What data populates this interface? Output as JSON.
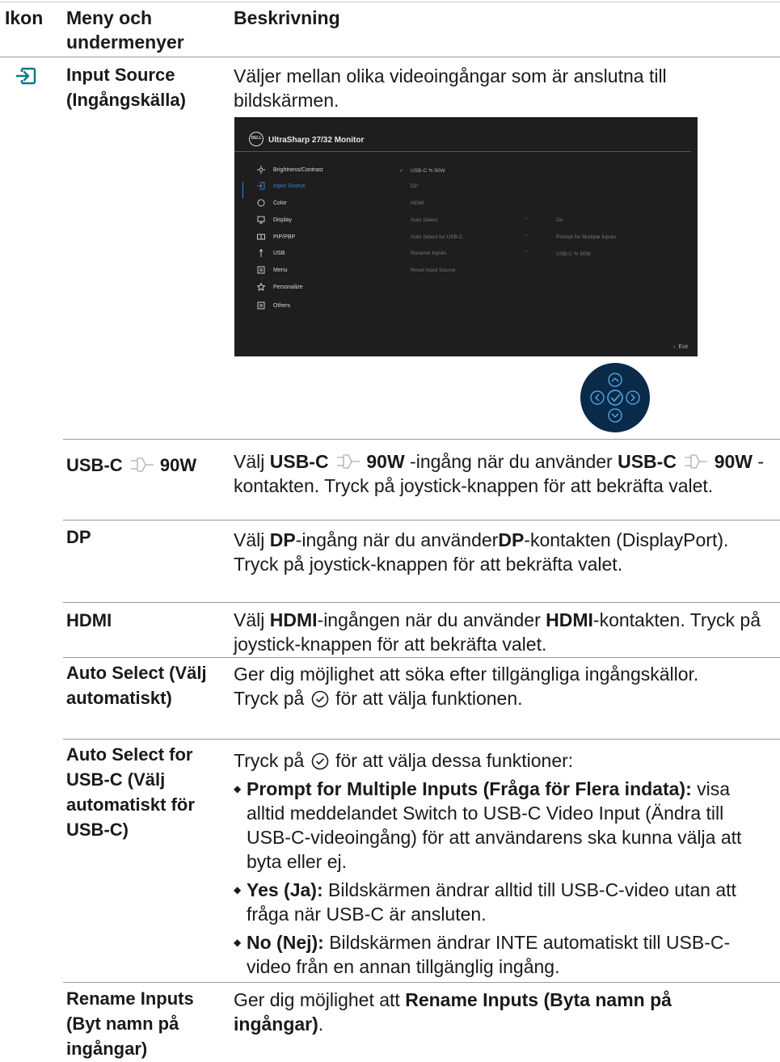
{
  "header": {
    "col_icon": "Ikon",
    "col_menu": "Meny och undermenyer",
    "col_desc": "Beskrivning"
  },
  "input_source": {
    "title": "Input Source (Ingångskälla)",
    "desc": "Väljer mellan olika videoingångar som är anslutna till bildskärmen."
  },
  "osd": {
    "logo": "DELL",
    "title": "UltraSharp 27/32 Monitor",
    "menu_items": [
      "Brightness/Contrast",
      "Input Source",
      "Color",
      "Display",
      "PIP/PBP",
      "USB",
      "Menu",
      "Personalize",
      "Others"
    ],
    "submenu": [
      "USB-C ⇆ 90W",
      "DP",
      "HDMI",
      "Auto Select",
      "Auto Select for USB-C",
      "Rename Inputs",
      "Reset Input Source"
    ],
    "values": [
      "On",
      "Prompt for Multiple Inputs",
      "USB-C ⇆ 90W"
    ],
    "exit": "Exit"
  },
  "rows": {
    "usbc": {
      "menu_a": "USB-C",
      "menu_b": "90W",
      "d1": "Välj ",
      "d1b": "USB-C",
      "d2b": "90W",
      "d2": " -ingång när du använder ",
      "d3b": "USB-C",
      "d4b": "90W",
      "d4": " -kontakten. Tryck på joystick-knappen för att bekräfta valet."
    },
    "dp": {
      "menu": "DP",
      "d1": "Välj ",
      "d1b": "DP",
      "d2": "-ingång när du använder",
      "d2b": "DP",
      "d3": "-kontakten (DisplayPort). Tryck på joystick-knappen för att bekräfta valet."
    },
    "hdmi": {
      "menu": "HDMI",
      "d1": "Välj ",
      "d1b": "HDMI",
      "d2": "-ingången när du använder ",
      "d2b": "HDMI",
      "d3": "-kontakten. Tryck på joystick-knappen för att bekräfta valet."
    },
    "auto": {
      "menu": "Auto Select (Välj automatiskt)",
      "d1": "Ger dig möjlighet att söka efter tillgängliga ingångskällor.",
      "d2a": "Tryck på",
      "d2b": "för att välja funktionen."
    },
    "auto_usbc": {
      "menu": "Auto Select for USB-C (Välj automatiskt för USB-C)",
      "intro_a": "Tryck på",
      "intro_b": "för att välja dessa funktioner:",
      "b1_bold": "Prompt for Multiple Inputs (Fråga för Flera indata):",
      "b1": " visa alltid meddelandet Switch to USB-C Video Input (Ändra till USB-C-videoingång) för att användarens ska kunna välja att byta eller ej.",
      "b2_bold": "Yes (Ja):",
      "b2": " Bildskärmen ändrar alltid till USB-C-video utan att fråga när USB-C är ansluten.",
      "b3_bold": "No (Nej):",
      "b3": " Bildskärmen ändrar INTE automatiskt till USB-C-video från en annan tillgänglig ingång."
    },
    "rename": {
      "menu": "Rename Inputs (Byt namn på ingångar)",
      "d1": "Ger dig möjlighet att ",
      "d1b": "Rename Inputs (Byta namn på ingångar)",
      "d2": "."
    }
  }
}
